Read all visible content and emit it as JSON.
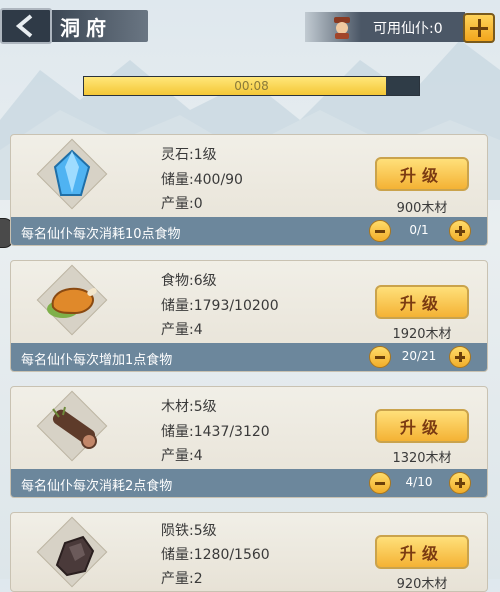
{
  "header": {
    "title": "洞府",
    "worker_label": "可用仙仆:0"
  },
  "timer": {
    "text": "00:08",
    "progress": 0.9
  },
  "buildings": [
    {
      "name_level": "灵石:1级",
      "storage": "储量:400/90",
      "output": "产量:0",
      "upgrade_label": "升级",
      "cost": "900木材",
      "footer": "每名仙仆每次消耗10点食物",
      "count": "0/1",
      "icon": "crystal-icon"
    },
    {
      "name_level": "食物:6级",
      "storage": "储量:1793/10200",
      "output": "产量:4",
      "upgrade_label": "升级",
      "cost": "1920木材",
      "footer": "每名仙仆每次增加1点食物",
      "count": "20/21",
      "icon": "meat-icon"
    },
    {
      "name_level": "木材:5级",
      "storage": "储量:1437/3120",
      "output": "产量:4",
      "upgrade_label": "升级",
      "cost": "1320木材",
      "footer": "每名仙仆每次消耗2点食物",
      "count": "4/10",
      "icon": "log-icon"
    },
    {
      "name_level": "陨铁:5级",
      "storage": "储量:1280/1560",
      "output": "产量:2",
      "upgrade_label": "升级",
      "cost": "920木材",
      "icon": "ore-icon"
    }
  ]
}
